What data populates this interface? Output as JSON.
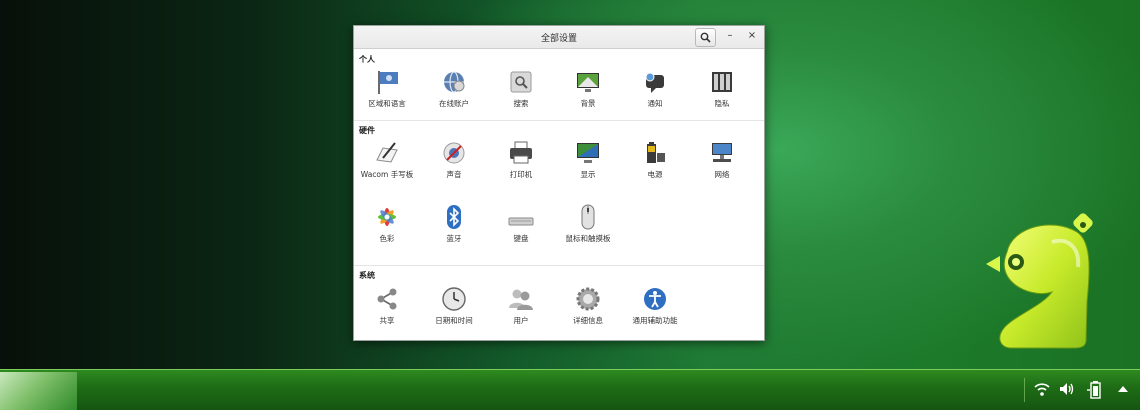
{
  "window": {
    "title": "全部设置",
    "search_button": "search-icon",
    "min_label": "–",
    "close_label": "×"
  },
  "sections": [
    {
      "title": "个人",
      "items": [
        {
          "label": "区域和语言",
          "icon": "flag-icon"
        },
        {
          "label": "在线账户",
          "icon": "online-accounts-icon"
        },
        {
          "label": "搜索",
          "icon": "search-settings-icon"
        },
        {
          "label": "背景",
          "icon": "background-icon"
        },
        {
          "label": "通知",
          "icon": "notification-icon"
        },
        {
          "label": "隐私",
          "icon": "privacy-icon"
        }
      ]
    },
    {
      "title": "硬件",
      "items": [
        {
          "label": "Wacom 手写板",
          "icon": "wacom-tablet-icon"
        },
        {
          "label": "声音",
          "icon": "sound-icon"
        },
        {
          "label": "打印机",
          "icon": "printer-icon"
        },
        {
          "label": "显示",
          "icon": "display-icon"
        },
        {
          "label": "电源",
          "icon": "power-icon"
        },
        {
          "label": "网络",
          "icon": "network-icon"
        },
        {
          "label": "色彩",
          "icon": "color-icon"
        },
        {
          "label": "蓝牙",
          "icon": "bluetooth-icon"
        },
        {
          "label": "键盘",
          "icon": "keyboard-icon"
        },
        {
          "label": "鼠标和触摸板",
          "icon": "mouse-icon"
        }
      ]
    },
    {
      "title": "系统",
      "items": [
        {
          "label": "共享",
          "icon": "share-icon"
        },
        {
          "label": "日期和时间",
          "icon": "clock-icon"
        },
        {
          "label": "用户",
          "icon": "users-icon"
        },
        {
          "label": "详细信息",
          "icon": "gear-icon"
        },
        {
          "label": "通用辅助功能",
          "icon": "accessibility-icon"
        }
      ]
    }
  ],
  "taskbar": {
    "tray": [
      "wifi-icon",
      "volume-icon",
      "battery-icon",
      "up-arrow-icon"
    ]
  },
  "colors": {
    "taskbar": "#1f6e16",
    "window_bg": "#ffffff"
  }
}
